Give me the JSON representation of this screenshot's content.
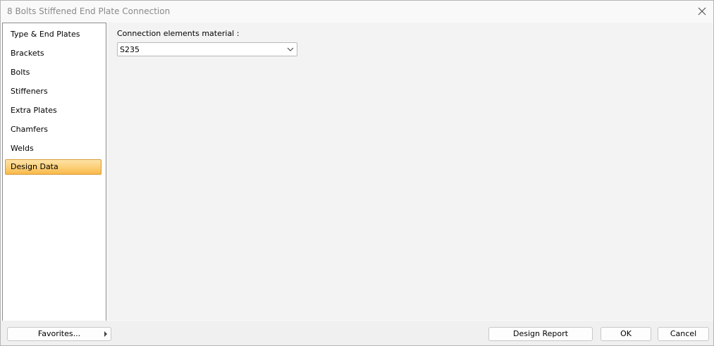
{
  "window": {
    "title": "8 Bolts Stiffened End Plate Connection"
  },
  "nav": {
    "items": [
      {
        "label": "Type & End Plates"
      },
      {
        "label": "Brackets"
      },
      {
        "label": "Bolts"
      },
      {
        "label": "Stiffeners"
      },
      {
        "label": "Extra Plates"
      },
      {
        "label": "Chamfers"
      },
      {
        "label": "Welds"
      },
      {
        "label": "Design Data",
        "selected": true
      }
    ]
  },
  "content": {
    "material_label": "Connection elements material :",
    "material_value": "S235"
  },
  "footer": {
    "favorites_label": "Favorites...",
    "design_report_label": "Design Report",
    "ok_label": "OK",
    "cancel_label": "Cancel"
  },
  "colors": {
    "selection_start": "#fde2a5",
    "selection_end": "#f9b94a",
    "accent": "#8a3fb7"
  },
  "icons": {
    "close": "close-icon",
    "dropdown": "chevron-down-icon",
    "submenu": "chevron-right-icon"
  }
}
